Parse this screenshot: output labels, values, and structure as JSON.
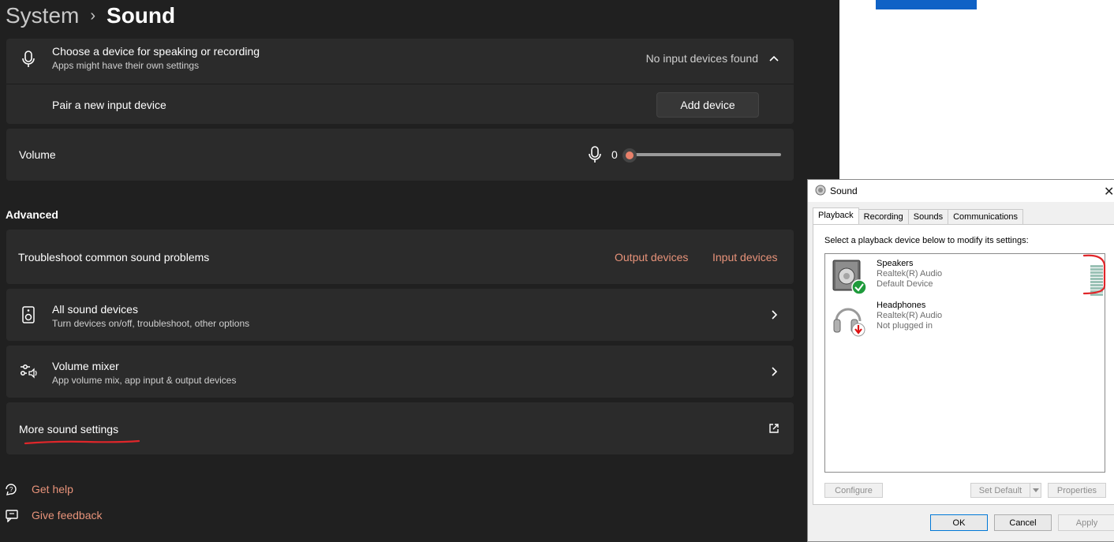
{
  "breadcrumb": {
    "parent": "System",
    "separator": "›",
    "current": "Sound"
  },
  "input_device": {
    "title": "Choose a device for speaking or recording",
    "subtitle": "Apps might have their own settings",
    "status": "No input devices found"
  },
  "pair_device": {
    "label": "Pair a new input device",
    "button": "Add device"
  },
  "volume": {
    "label": "Volume",
    "value": "0",
    "level_fraction": 0
  },
  "advanced": {
    "heading": "Advanced",
    "troubleshoot": {
      "label": "Troubleshoot common sound problems",
      "output_link": "Output devices",
      "input_link": "Input devices"
    },
    "all_devices": {
      "title": "All sound devices",
      "subtitle": "Turn devices on/off, troubleshoot, other options"
    },
    "mixer": {
      "title": "Volume mixer",
      "subtitle": "App volume mix, app input & output devices"
    },
    "more": {
      "title": "More sound settings"
    }
  },
  "footer": {
    "help": "Get help",
    "feedback": "Give feedback"
  },
  "sound_dialog": {
    "title": "Sound",
    "close": "✕",
    "tabs": [
      "Playback",
      "Recording",
      "Sounds",
      "Communications"
    ],
    "active_tab": "Playback",
    "instruction": "Select a playback device below to modify its settings:",
    "devices": [
      {
        "name": "Speakers",
        "driver": "Realtek(R) Audio",
        "status": "Default Device",
        "icon": "speaker-default-icon"
      },
      {
        "name": "Headphones",
        "driver": "Realtek(R) Audio",
        "status": "Not plugged in",
        "icon": "headphones-unplugged-icon"
      }
    ],
    "buttons": {
      "configure": "Configure",
      "set_default": "Set Default",
      "properties": "Properties",
      "ok": "OK",
      "cancel": "Cancel",
      "apply": "Apply"
    }
  },
  "colors": {
    "accent_link": "#e8937a",
    "annotation_red": "#e0262a",
    "card_bg": "#2b2b2b",
    "page_bg": "#202020"
  }
}
